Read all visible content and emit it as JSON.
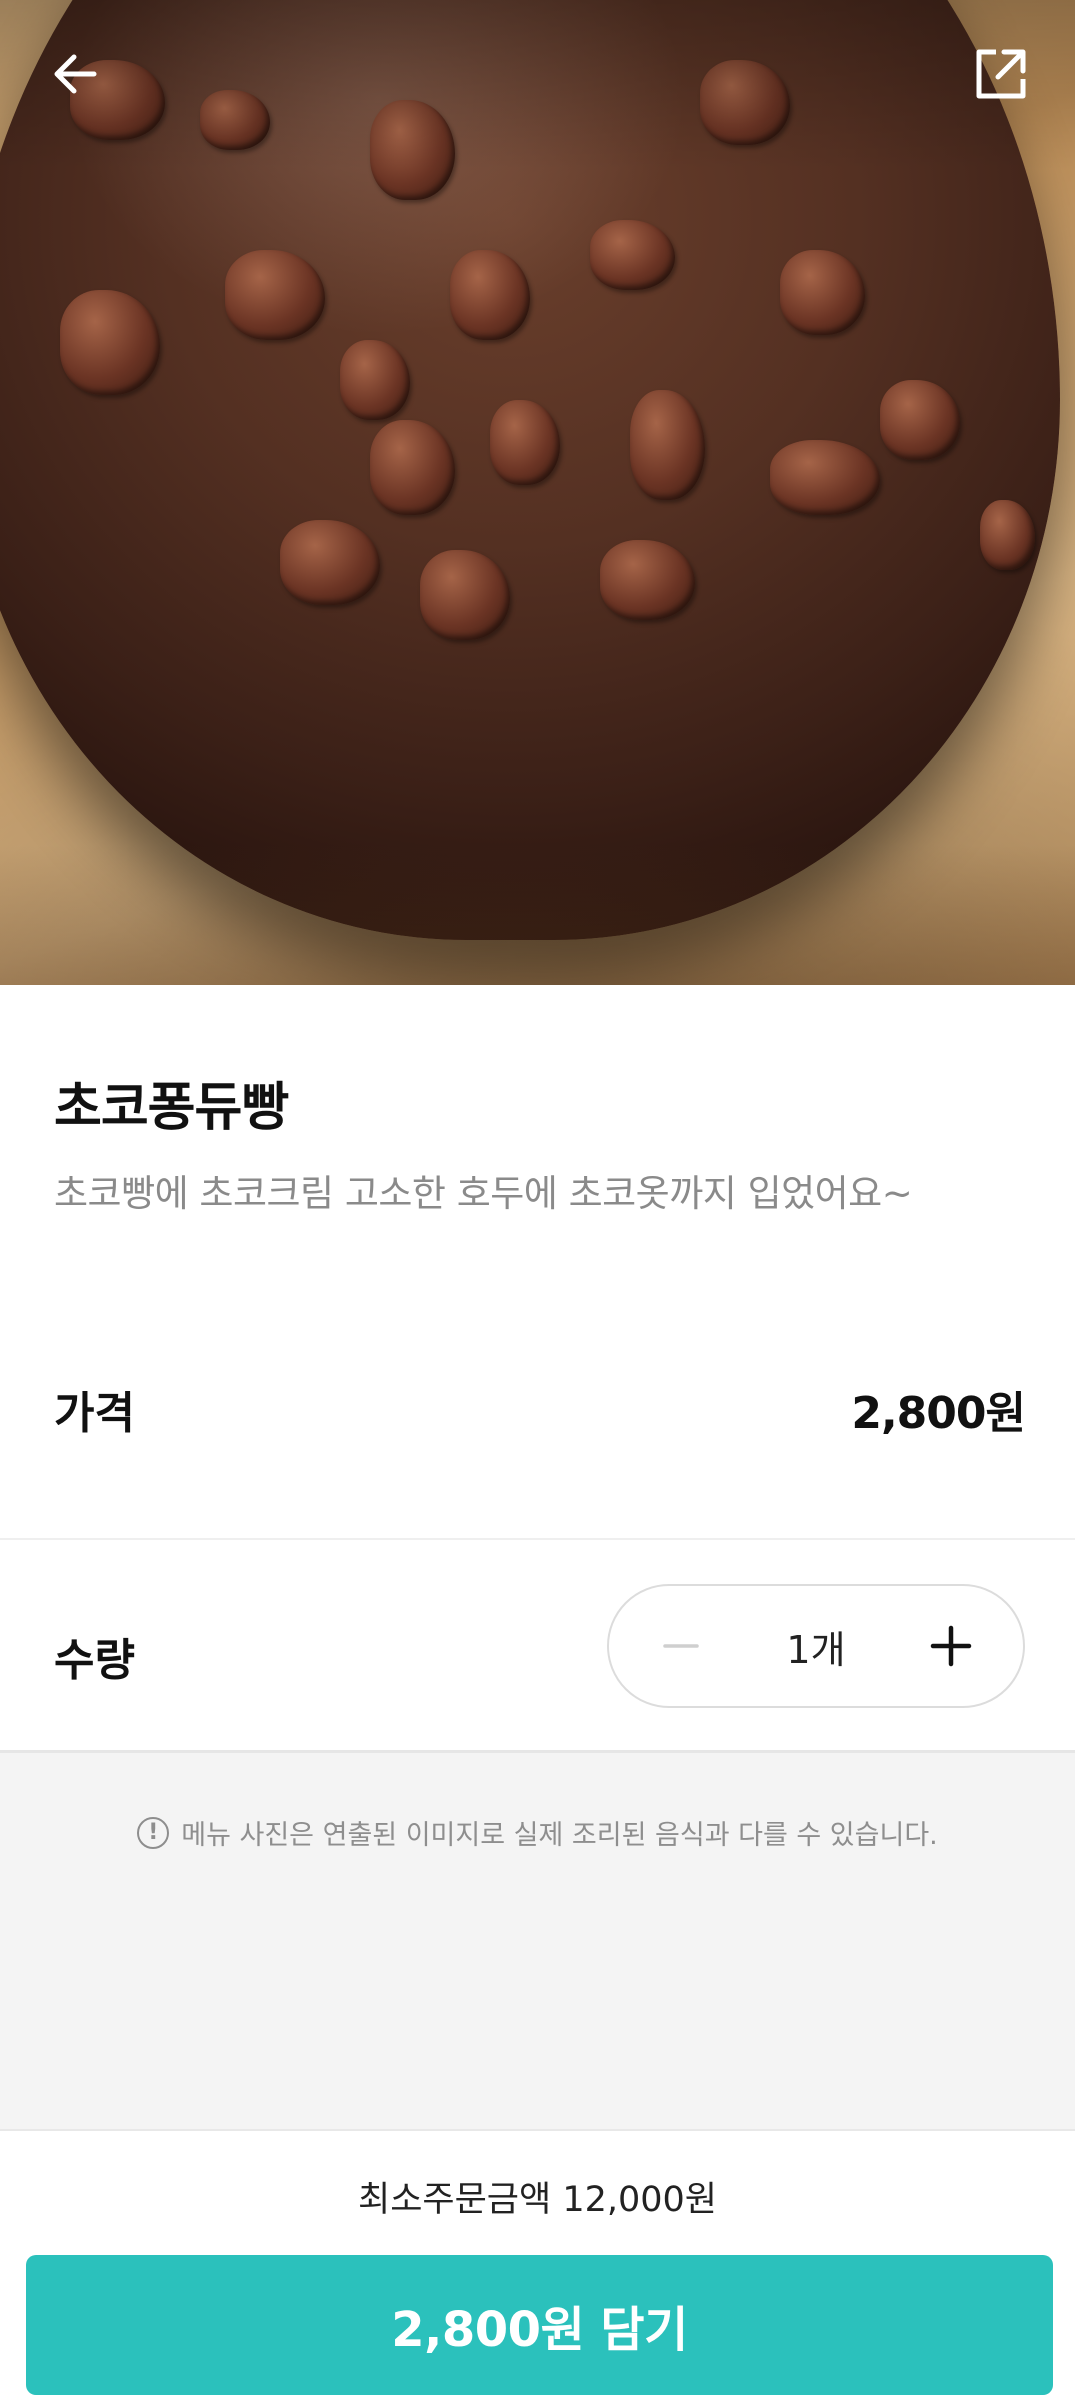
{
  "header": {
    "back_icon": "arrow-left-icon",
    "share_icon": "share-external-icon"
  },
  "product": {
    "name": "초코퐁듀빵",
    "description": "초코빵에 초코크림 고소한 호두에 초코옷까지 입었어요~",
    "image_alt": "chocolate-covered bread with walnuts"
  },
  "price": {
    "label": "가격",
    "value": "2,800원"
  },
  "quantity": {
    "label": "수량",
    "value": "1개",
    "minus_icon": "minus-icon",
    "plus_icon": "plus-icon",
    "minus_disabled": true
  },
  "notice": {
    "icon": "exclamation-circle-icon",
    "text": "메뉴 사진은 연출된 이미지로 실제 조리된 음식과 다를 수 있습니다."
  },
  "footer": {
    "min_order": "최소주문금액 12,000원",
    "add_button": "2,800원 담기"
  },
  "colors": {
    "accent": "#2bc1bc",
    "muted_text": "#8a8a8a",
    "notice_bg": "#f4f4f4"
  }
}
